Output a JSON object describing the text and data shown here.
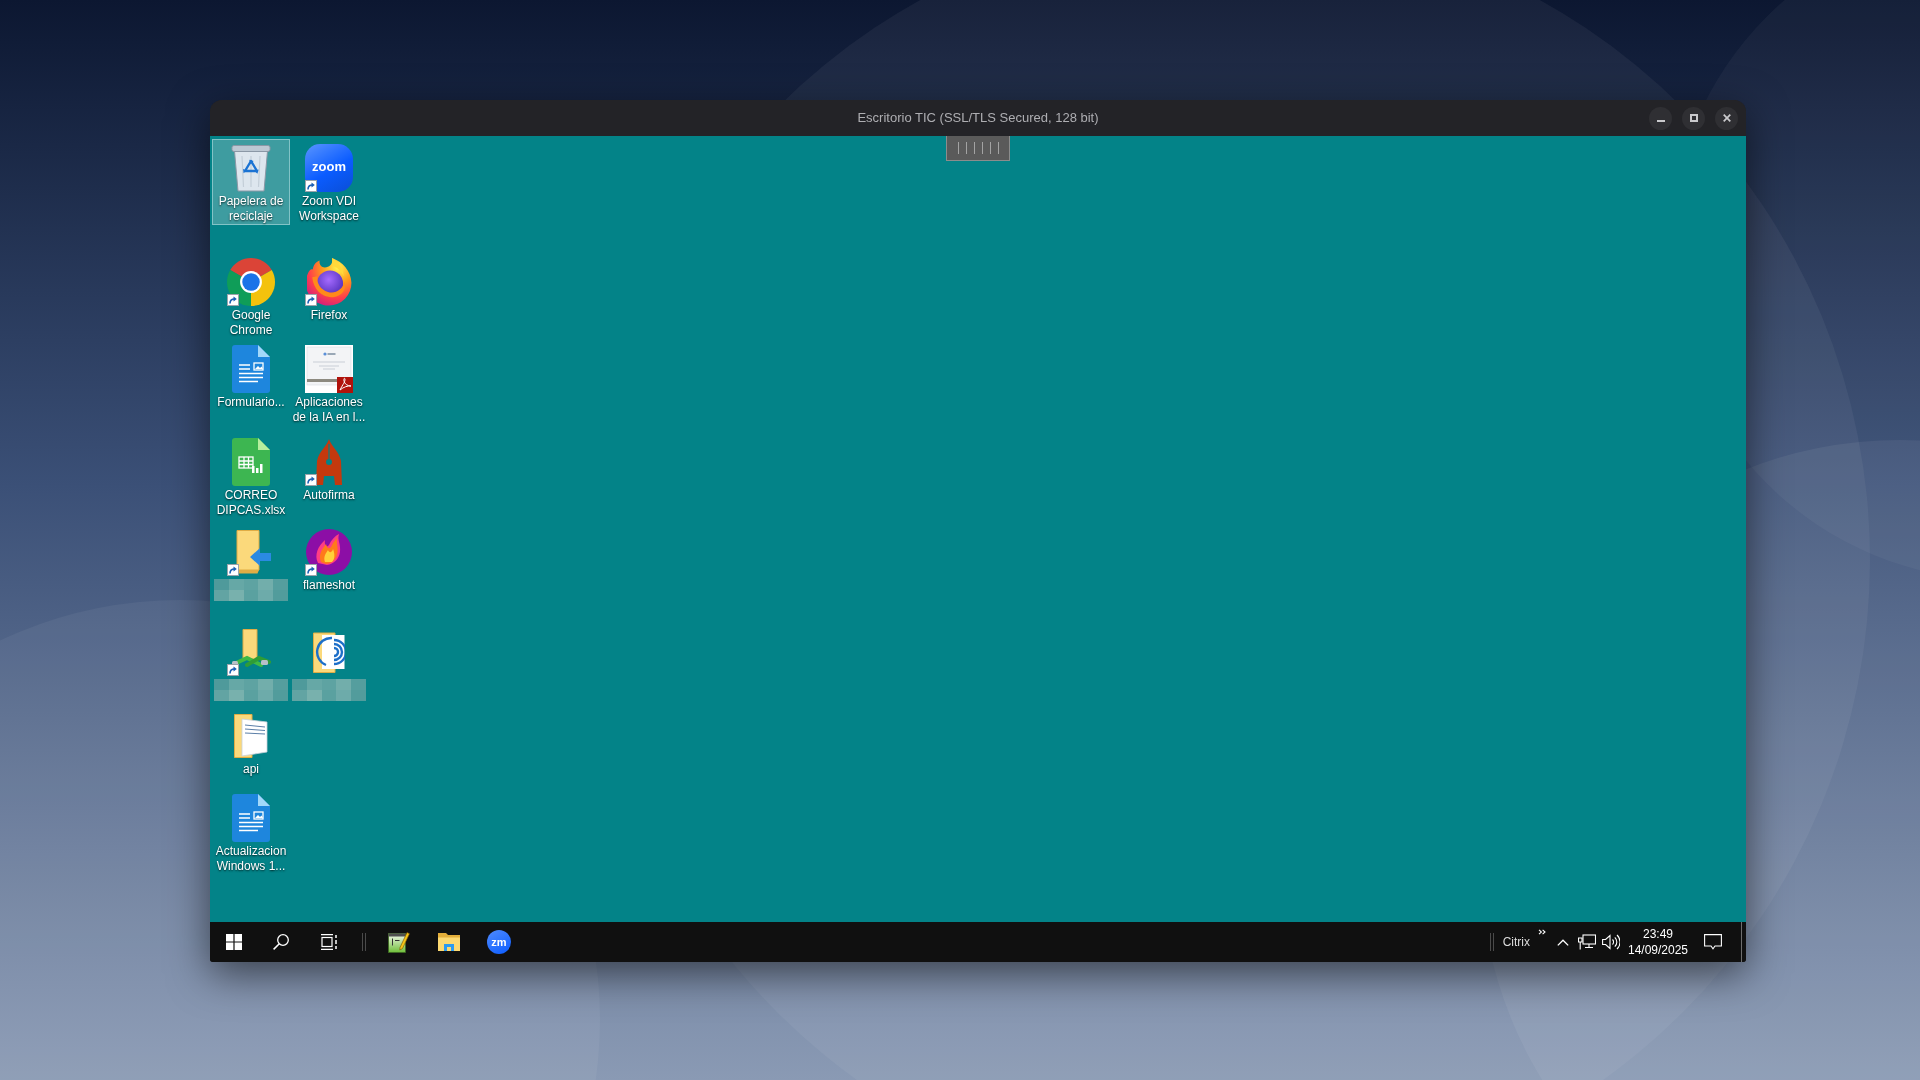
{
  "window": {
    "title": "Escritorio TIC (SSL/TLS Secured, 128 bit)"
  },
  "desktop": {
    "rows": [
      {
        "icons": [
          {
            "kind": "recycle-bin",
            "label": "Papelera de reciclaje",
            "selected": true,
            "shortcut": false
          },
          {
            "kind": "zoom",
            "logo_text": "zoom",
            "label": "Zoom VDI Workspace",
            "selected": false,
            "shortcut": true
          }
        ]
      },
      {
        "icons": [
          {
            "kind": "chrome",
            "label": "Google Chrome",
            "selected": false,
            "shortcut": true
          },
          {
            "kind": "firefox",
            "label": "Firefox",
            "selected": false,
            "shortcut": true
          }
        ]
      },
      {
        "icons": [
          {
            "kind": "document",
            "label": "Formulario...",
            "selected": false,
            "shortcut": false
          },
          {
            "kind": "pdf",
            "label": "Aplicaciones de la IA en l...",
            "selected": false,
            "shortcut": false
          }
        ]
      },
      {
        "icons": [
          {
            "kind": "spreadsheet",
            "label": "CORREO DIPCAS.xlsx",
            "selected": false,
            "shortcut": false
          },
          {
            "kind": "pen-nib",
            "label": "Autofirma",
            "selected": false,
            "shortcut": true
          }
        ]
      },
      {
        "icons": [
          {
            "kind": "folder-arrow",
            "label_obscured": true,
            "selected": false,
            "shortcut": true
          },
          {
            "kind": "flame",
            "label": "flameshot",
            "selected": false,
            "shortcut": true
          }
        ]
      },
      {
        "icons": [
          {
            "kind": "folder-cable",
            "label_obscured": true,
            "selected": false,
            "shortcut": true
          },
          {
            "kind": "folder-swirl",
            "label_obscured": true,
            "selected": false,
            "shortcut": false
          }
        ]
      },
      {
        "icons": [
          {
            "kind": "folder-pages",
            "label": "api",
            "selected": false,
            "shortcut": false
          }
        ]
      },
      {
        "icons": [
          {
            "kind": "document",
            "label": "Actualizacion Windows 1...",
            "selected": false,
            "shortcut": false
          }
        ]
      }
    ]
  },
  "taskbar": {
    "pinned": [
      {
        "kind": "notepad"
      },
      {
        "kind": "explorer"
      },
      {
        "kind": "zoom",
        "logo_text": "zm"
      }
    ],
    "tray": {
      "label": "Citrix",
      "time": "23:49",
      "date": "14/09/2025"
    }
  }
}
